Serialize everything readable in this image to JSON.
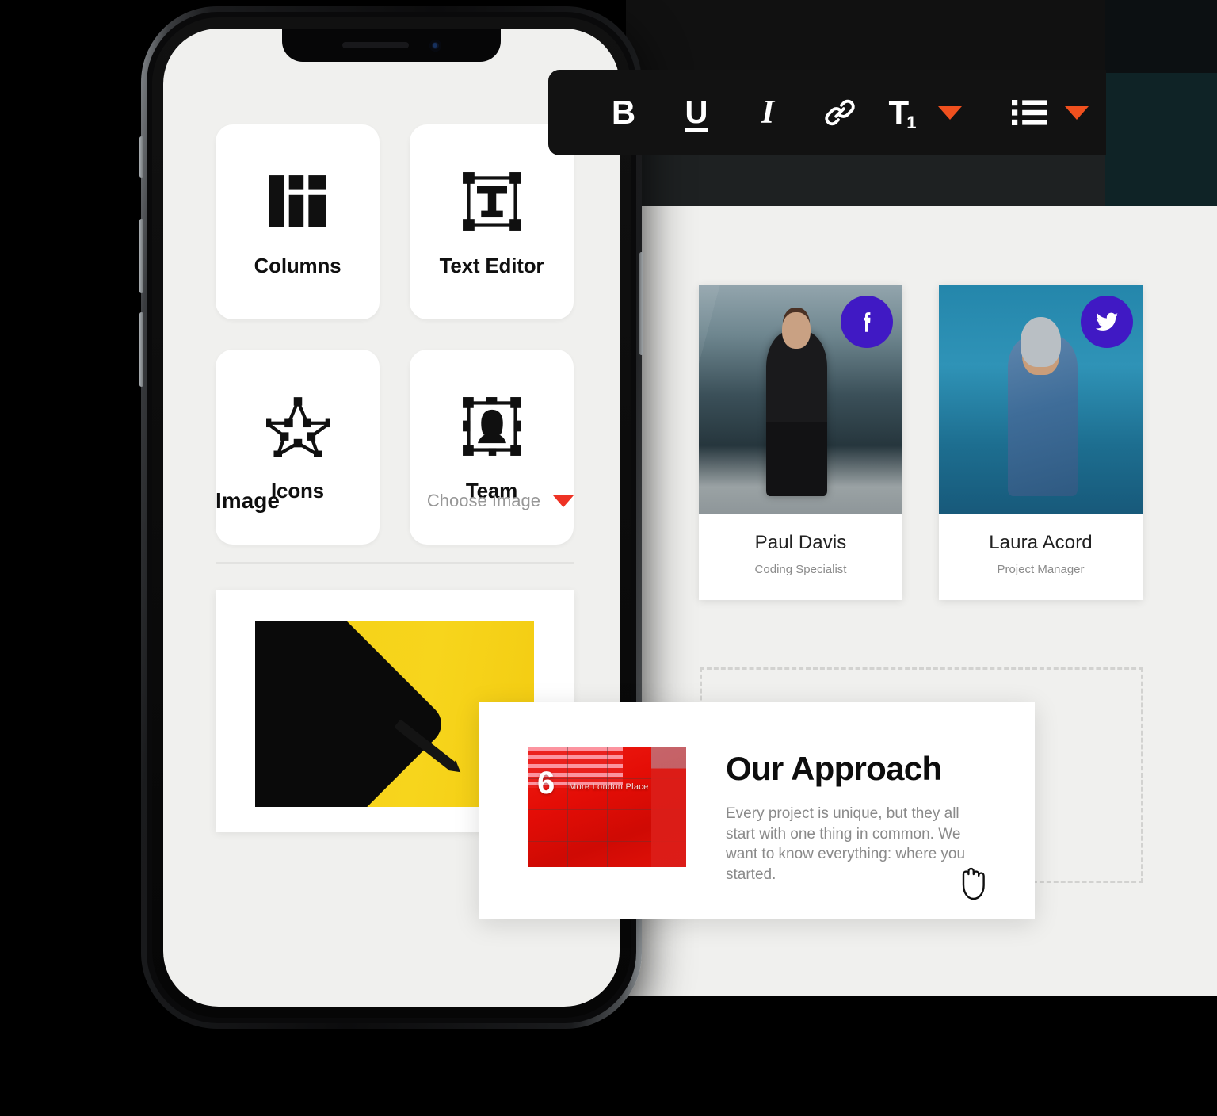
{
  "theme": {
    "page_bg": "#000000",
    "panel_bg": "#f0f0ee",
    "toolbar_bg": "#121212",
    "accent_orange": "#f0501e",
    "accent_red": "#ee3224",
    "social_purple": "#4019c4",
    "card_white": "#ffffff"
  },
  "format_toolbar": {
    "bold_label": "B",
    "underline_label": "U",
    "italic_label": "I",
    "link_icon": "link-icon",
    "heading_letter": "T",
    "heading_level": "1",
    "heading_caret_icon": "caret-down-icon",
    "list_icon": "bulleted-list-icon",
    "list_caret_icon": "caret-down-icon"
  },
  "phone": {
    "tools": [
      {
        "label": "Columns",
        "icon": "columns-layout-icon"
      },
      {
        "label": "Text Editor",
        "icon": "text-box-icon"
      },
      {
        "label": "Icons",
        "icon": "star-outline-icon"
      },
      {
        "label": "Team",
        "icon": "person-box-icon"
      }
    ],
    "image_section": {
      "title": "Image",
      "chooser_label": "Choose Image",
      "chooser_caret_icon": "caret-down-icon",
      "preview_alt": "black tablet and pencil on yellow background"
    }
  },
  "builder": {
    "team_members": [
      {
        "name": "Paul Davis",
        "role": "Coding Specialist",
        "social_icon": "facebook-icon",
        "photo_alt": "man in black hoodie in front of glass building"
      },
      {
        "name": "Laura Acord",
        "role": "Project Manager",
        "social_icon": "twitter-icon",
        "photo_alt": "woman in denim jacket against blue wall"
      }
    ],
    "drop_zone_label": ""
  },
  "approach_card": {
    "title": "Our Approach",
    "body": "Every project is unique, but they all start with one thing in common. We want to know everything: where you started.",
    "image": {
      "number": "6",
      "caption": "More London Place",
      "alt": "red building facade"
    },
    "cursor_icon": "grab-hand-cursor-icon"
  }
}
